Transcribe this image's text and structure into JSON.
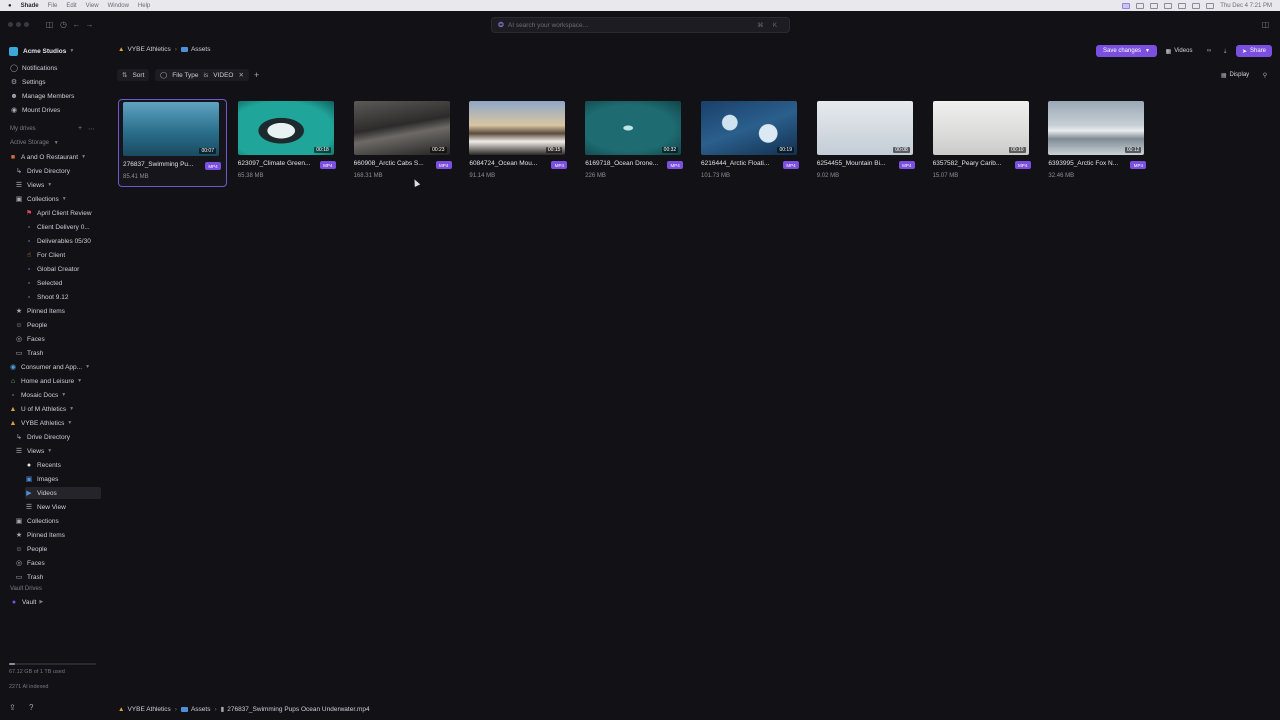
{
  "menubar": {
    "app_name": "Shade",
    "items": [
      "File",
      "Edit",
      "View",
      "Window",
      "Help"
    ],
    "clock": "Thu Dec 4  7:21 PM"
  },
  "search": {
    "placeholder": "AI search your workspace...",
    "shortcut": "⌘ K"
  },
  "workspace": {
    "name": "Acme Studios"
  },
  "sidebar": {
    "top_items": [
      {
        "label": "Notifications",
        "icon": "bell-icon"
      },
      {
        "label": "Settings",
        "icon": "gear-icon"
      },
      {
        "label": "Manage Members",
        "icon": "users-icon"
      },
      {
        "label": "Mount Drives",
        "icon": "drive-icon"
      }
    ],
    "my_drives_label": "My drives",
    "active_storage_label": "Active Storage",
    "tree": [
      {
        "label": "A and O Restaurant",
        "indent": 0,
        "icon": "restaurant-icon",
        "chevron": true
      },
      {
        "label": "Drive Directory",
        "indent": 1,
        "icon": "tree-icon"
      },
      {
        "label": "Views",
        "indent": 1,
        "icon": "layers-icon",
        "chevron": true
      },
      {
        "label": "Collections",
        "indent": 1,
        "icon": "collection-icon",
        "chevron": true
      },
      {
        "label": "April Client Review",
        "indent": 2,
        "icon": "flag-icon"
      },
      {
        "label": "Client Delivery 0...",
        "indent": 2,
        "icon": "doc-icon"
      },
      {
        "label": "Deliverables 05/30",
        "indent": 2,
        "icon": "doc-icon"
      },
      {
        "label": "For Client",
        "indent": 2,
        "icon": "thumbs-up-icon"
      },
      {
        "label": "Global Creator",
        "indent": 2,
        "icon": "doc-icon"
      },
      {
        "label": "Selected",
        "indent": 2,
        "icon": "doc-icon"
      },
      {
        "label": "Shoot 9.12",
        "indent": 2,
        "icon": "doc-icon"
      },
      {
        "label": "Pinned Items",
        "indent": 1,
        "icon": "pin-icon"
      },
      {
        "label": "People",
        "indent": 1,
        "icon": "person-icon"
      },
      {
        "label": "Faces",
        "indent": 1,
        "icon": "face-icon"
      },
      {
        "label": "Trash",
        "indent": 1,
        "icon": "trash-icon"
      },
      {
        "label": "Consumer and App...",
        "indent": 0,
        "icon": "globe-icon",
        "chevron": true
      },
      {
        "label": "Home and Leisure",
        "indent": 0,
        "icon": "house-icon",
        "chevron": true
      },
      {
        "label": "Mosaic Docs",
        "indent": 0,
        "icon": "doc-icon",
        "chevron": true
      },
      {
        "label": "U of M Athletics",
        "indent": 0,
        "icon": "athletics-icon",
        "chevron": true
      },
      {
        "label": "VYBE Athletics",
        "indent": 0,
        "icon": "runner-icon",
        "chevron": true
      },
      {
        "label": "Drive Directory",
        "indent": 1,
        "icon": "tree-icon"
      },
      {
        "label": "Views",
        "indent": 1,
        "icon": "layers-icon",
        "chevron": true
      },
      {
        "label": "Recents",
        "indent": 2,
        "icon": "clock-icon"
      },
      {
        "label": "Images",
        "indent": 2,
        "icon": "image-icon"
      },
      {
        "label": "Videos",
        "indent": 2,
        "icon": "video-icon",
        "selected": true
      },
      {
        "label": "New View",
        "indent": 2,
        "icon": "layers-icon"
      },
      {
        "label": "Collections",
        "indent": 1,
        "icon": "collection-icon"
      },
      {
        "label": "Pinned Items",
        "indent": 1,
        "icon": "pin-icon"
      },
      {
        "label": "People",
        "indent": 1,
        "icon": "person-icon"
      },
      {
        "label": "Faces",
        "indent": 1,
        "icon": "face-icon"
      },
      {
        "label": "Trash",
        "indent": 1,
        "icon": "trash-icon"
      }
    ],
    "vault_drives_label": "Vault Drives",
    "vault": {
      "label": "Vault",
      "icon": "vault-icon"
    },
    "storage_text": "67.12 GB of 1 TB used",
    "storage_fraction": 0.067,
    "indexed_text": "2271 AI indexed"
  },
  "header": {
    "breadcrumb": [
      "VYBE Athletics",
      "Assets"
    ],
    "save_label": "Save changes",
    "view_label": "Videos",
    "share_label": "Share",
    "sort_label": "Sort",
    "display_label": "Display",
    "filter": {
      "field": "File Type",
      "op": "is",
      "value": "VIDEO"
    }
  },
  "assets": [
    {
      "name": "276837_Swimming Pu...",
      "size": "85.41 MB",
      "duration": "00:07",
      "type": "MP4"
    },
    {
      "name": "623097_Climate Green...",
      "size": "65.38 MB",
      "duration": "00:18",
      "type": "MP4"
    },
    {
      "name": "660908_Arctic Cabs S...",
      "size": "168.31 MB",
      "duration": "00:23",
      "type": "MP4"
    },
    {
      "name": "6084724_Ocean Mou...",
      "size": "91.14 MB",
      "duration": "00:15",
      "type": "MP4"
    },
    {
      "name": "6169718_Ocean Drone...",
      "size": "226 MB",
      "duration": "00:32",
      "type": "MP4"
    },
    {
      "name": "6216444_Arctic Floati...",
      "size": "101.73 MB",
      "duration": "00:19",
      "type": "MP4"
    },
    {
      "name": "6254455_Mountain Bi...",
      "size": "9.02 MB",
      "duration": "00:08",
      "type": "MP4"
    },
    {
      "name": "6357582_Peary Carib...",
      "size": "15.07 MB",
      "duration": "00:10",
      "type": "MP4"
    },
    {
      "name": "6393995_Arctic Fox N...",
      "size": "32.46 MB",
      "duration": "00:12",
      "type": "MP4"
    }
  ],
  "footer_breadcrumb": [
    "VYBE Athletics",
    "Assets",
    "276837_Swimming Pups Ocean Underwater.mp4"
  ]
}
